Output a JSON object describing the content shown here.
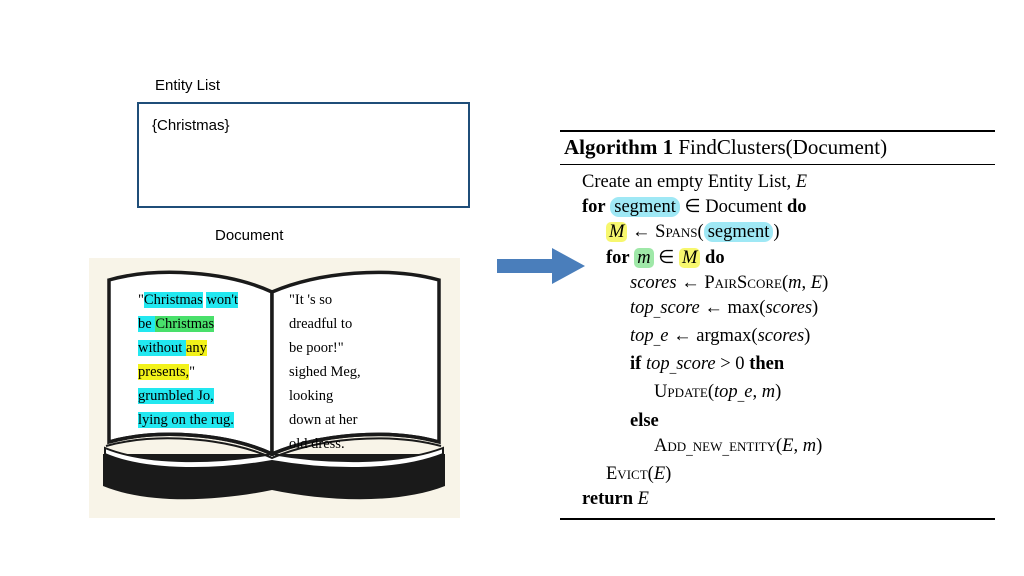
{
  "left_panel": {
    "entity_list_label": "Entity List",
    "entity_list_contents": "{Christmas}",
    "document_label": "Document"
  },
  "book": {
    "left_page_lines": [
      [
        {
          "text": "\"",
          "hl": "none"
        },
        {
          "text": "Christmas",
          "hl": "cyan"
        },
        {
          "text": " ",
          "hl": "none"
        },
        {
          "text": "won't",
          "hl": "cyan"
        }
      ],
      [
        {
          "text": "be ",
          "hl": "cyan"
        },
        {
          "text": "Christmas",
          "hl": "green"
        }
      ],
      [
        {
          "text": "without ",
          "hl": "cyan"
        },
        {
          "text": "any",
          "hl": "yellow"
        }
      ],
      [
        {
          "text": "presents,",
          "hl": "yellow"
        },
        {
          "text": "\"",
          "hl": "none"
        }
      ],
      [
        {
          "text": "grumbled ",
          "hl": "cyan"
        },
        {
          "text": "Jo,",
          "hl": "cyan"
        }
      ],
      [
        {
          "text": "lying on ",
          "hl": "cyan"
        },
        {
          "text": "the rug.",
          "hl": "cyan"
        }
      ]
    ],
    "right_page_lines": [
      "\"It 's so",
      "dreadful to",
      "be poor!\"",
      "sighed Meg,",
      "looking",
      "down at her",
      "old dress."
    ]
  },
  "algorithm": {
    "number_label": "Algorithm 1",
    "name_label": "FindClusters(Document)",
    "lines": [
      {
        "indent": 0,
        "html": "Create an empty Entity List, <span class=\"it\">E</span>"
      },
      {
        "indent": 0,
        "html": "<span class=\"kw\">for</span> <span class=\"box-cyan\">segment</span> &#8712; Document <span class=\"kw\">do</span>"
      },
      {
        "indent": 1,
        "html": "<span class=\"box-yellow it\">M</span> &#8592; <span class=\"sc\">Spans</span>(<span class=\"box-cyan\">segment</span>)"
      },
      {
        "indent": 1,
        "html": "<span class=\"kw\">for</span> <span class=\"box-green it\">m</span> &#8712; <span class=\"box-yellow it\">M</span> <span class=\"kw\">do</span>"
      },
      {
        "indent": 2,
        "html": "<span class=\"it\">scores</span> &#8592; <span class=\"sc\">PairScore</span>(<span class=\"it\">m</span>, <span class=\"it\">E</span>)"
      },
      {
        "indent": 2,
        "html": "<span class=\"it\">top_score</span> &#8592; max(<span class=\"it\">scores</span>)"
      },
      {
        "indent": 2,
        "html": "<span class=\"it\">top_e</span> &#8592; argmax(<span class=\"it\">scores</span>)"
      },
      {
        "indent": 2,
        "html": "<span class=\"kw\">if</span> <span class=\"it\">top_score</span> &gt; 0 <span class=\"kw\">then</span>"
      },
      {
        "indent": 3,
        "html": "<span class=\"sc\">Update</span>(<span class=\"it\">top_e</span>, <span class=\"it\">m</span>)"
      },
      {
        "indent": 2,
        "html": "<span class=\"kw\">else</span>"
      },
      {
        "indent": 3,
        "html": "<span class=\"sc\">Add_new_entity</span>(<span class=\"it\">E</span>, <span class=\"it\">m</span>)"
      },
      {
        "indent": 1,
        "html": "<span class=\"sc\">Evict</span>(<span class=\"it\">E</span>)"
      },
      {
        "indent": 0,
        "html": "<span class=\"kw\">return</span> <span class=\"it\">E</span>"
      }
    ]
  },
  "colors": {
    "box_border": "#1f4e79",
    "arrow": "#4a7ebb",
    "highlight_cyan": "#22e8f0",
    "highlight_green": "#49e06b",
    "highlight_yellow": "#f2f21a",
    "algo_box_cyan": "#9fe8f5",
    "algo_box_yellow": "#f7f76e",
    "algo_box_green": "#9fe8a8",
    "book_bg": "#f8f4e8"
  },
  "icons": {
    "arrow": "right-arrow-icon",
    "book": "open-book-icon"
  }
}
